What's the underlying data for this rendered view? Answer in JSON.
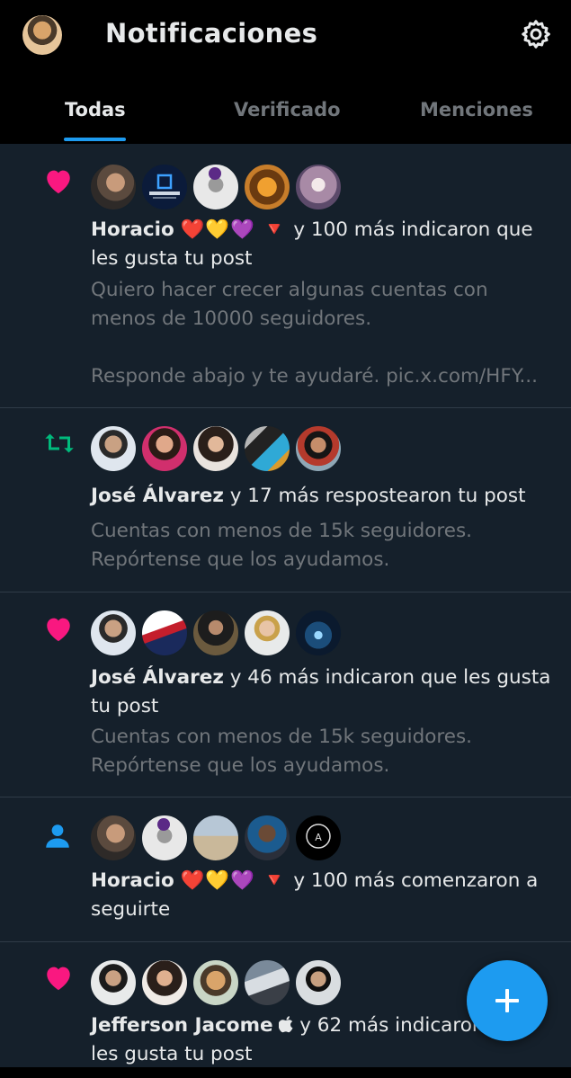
{
  "header": {
    "title": "Notificaciones",
    "avatar_icon": "profile-avatar",
    "settings_icon": "gear-icon"
  },
  "tabs": [
    {
      "label": "Todas",
      "active": true
    },
    {
      "label": "Verificado",
      "active": false
    },
    {
      "label": "Menciones",
      "active": false
    }
  ],
  "notifications": [
    {
      "type": "like",
      "icon": "heart-icon",
      "name": "Horacio",
      "decor": "❤️💛💜 🔻",
      "action": " y 100 más indicaron que les gusta tu post",
      "preview": "Quiero hacer crecer algunas cuentas con menos de 10000 seguidores.\n\nResponde abajo y te ayudaré. pic.x.com/HFY..."
    },
    {
      "type": "repost",
      "icon": "repost-icon",
      "name": "José Álvarez",
      "decor": "",
      "action": " y 17 más respostearon tu post",
      "preview": "Cuentas con menos de 15k seguidores.\nRepórtense que los ayudamos."
    },
    {
      "type": "like",
      "icon": "heart-icon",
      "name": "José Álvarez",
      "decor": "",
      "action": " y 46 más indicaron que les gusta tu post",
      "preview": "Cuentas con menos de 15k seguidores.\nRepórtense que los ayudamos."
    },
    {
      "type": "follow",
      "icon": "person-icon",
      "name": "Horacio",
      "decor": "❤️💛💜 🔻",
      "action": " y 100 más comenzaron a seguirte",
      "preview": ""
    },
    {
      "type": "like",
      "icon": "heart-icon",
      "name": "Jefferson Jacome",
      "decor": "",
      "action": " y 62 más indicaron que les gusta tu post",
      "preview": ""
    }
  ],
  "fab": {
    "icon": "plus-icon"
  },
  "colors": {
    "background": "#15202b",
    "header": "#000000",
    "accent": "#1d9bf0",
    "like": "#f91880",
    "repost": "#00ba7c",
    "muted": "#71767b"
  }
}
